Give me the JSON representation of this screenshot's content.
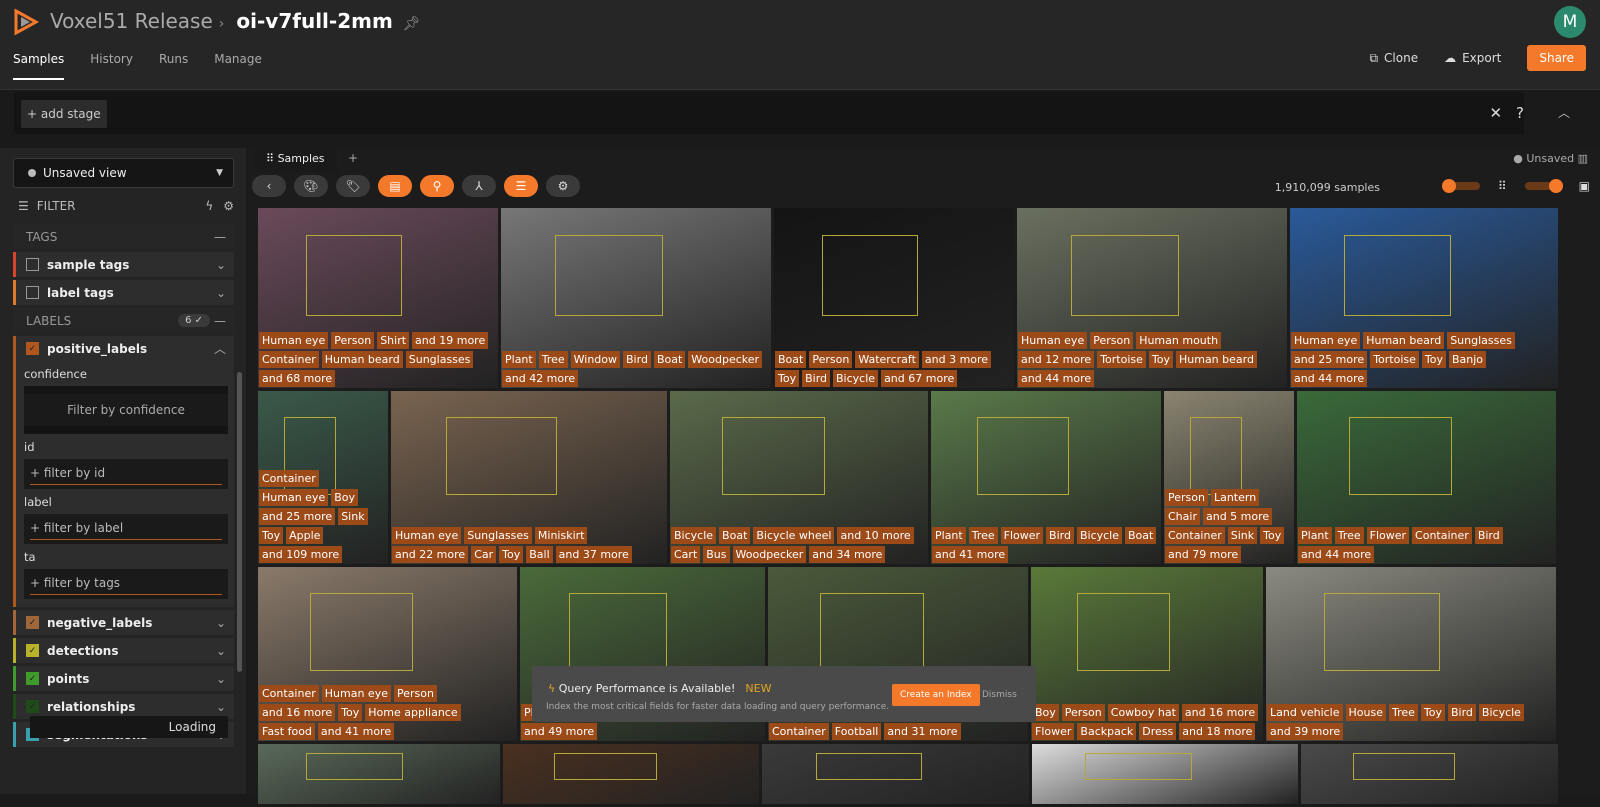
{
  "header": {
    "org": "Voxel51 Release",
    "dataset": "oi-v7full-2mm",
    "avatar": "M",
    "accent": "#f5792a"
  },
  "nav": [
    {
      "label": "Samples"
    },
    {
      "label": "History"
    },
    {
      "label": "Runs"
    },
    {
      "label": "Manage"
    }
  ],
  "actions": {
    "clone": "Clone",
    "export": "Export",
    "share": "Share"
  },
  "stage": {
    "add": "+ add stage"
  },
  "sidebar": {
    "view": "Unsaved view",
    "filter": "FILTER",
    "tags_section": "TAGS",
    "labels_section": "LABELS",
    "labels_count": "6 ✓",
    "sample_tags": "sample tags",
    "label_tags": "label tags",
    "positive": "positive_labels",
    "confidence": "confidence",
    "confidence_placeholder": "Filter by confidence",
    "id": "id",
    "id_placeholder": "+ filter by id",
    "label": "label",
    "label_placeholder": "+ filter by label",
    "tags_label": "ta",
    "tags_placeholder": "+ filter by tags",
    "loading": "Loading",
    "fields": [
      {
        "name": "negative_labels",
        "color": "#a0673a"
      },
      {
        "name": "detections",
        "color": "#b8b22a"
      },
      {
        "name": "points",
        "color": "#3f9b2c"
      },
      {
        "name": "relationships",
        "color": "#1f4a1a"
      },
      {
        "name": "segmentations",
        "color": "#3aa0b0"
      }
    ]
  },
  "grid": {
    "tab": "Samples",
    "unsaved": "Unsaved",
    "count": "1,910,099 samples",
    "rows": [
      [
        {
          "w": 240,
          "c": "#6a4a5a",
          "l": [
            "Human eye",
            "Person",
            "Shirt",
            "and 19 more",
            "Container",
            "Human beard",
            "Sunglasses",
            "and 68 more"
          ]
        },
        {
          "w": 270,
          "c": "#777777",
          "l": [
            "Plant",
            "Tree",
            "Window",
            "Bird",
            "Boat",
            "Woodpecker",
            "and 42 more"
          ]
        },
        {
          "w": 240,
          "c": "#141414",
          "l": [
            "Boat",
            "Person",
            "Watercraft",
            "and 3 more",
            "Toy",
            "Bird",
            "Bicycle",
            "and 67 more"
          ]
        },
        {
          "w": 270,
          "c": "#6a7060",
          "l": [
            "Human eye",
            "Person",
            "Human mouth",
            "and 12 more",
            "Tortoise",
            "Toy",
            "Human beard",
            "and 44 more"
          ]
        },
        {
          "w": 268,
          "c": "#2a5a9a",
          "l": [
            "Human eye",
            "Human beard",
            "Sunglasses",
            "and 25 more",
            "Tortoise",
            "Toy",
            "Banjo",
            "and 44 more"
          ]
        }
      ],
      [
        {
          "w": 130,
          "c": "#3a5a4a",
          "l": [
            "Container",
            "Human eye",
            "Boy",
            "and 25 more",
            "Sink",
            "Toy",
            "Apple",
            "and 109 more"
          ]
        },
        {
          "w": 276,
          "c": "#7a6450",
          "l": [
            "Human eye",
            "Sunglasses",
            "Miniskirt",
            "and 22 more",
            "Car",
            "Toy",
            "Ball",
            "and 37 more"
          ]
        },
        {
          "w": 258,
          "c": "#5a6a4a",
          "l": [
            "Bicycle",
            "Boat",
            "Bicycle wheel",
            "and 10 more",
            "Cart",
            "Bus",
            "Woodpecker",
            "and 34 more"
          ]
        },
        {
          "w": 230,
          "c": "#5a7a4a",
          "l": [
            "Plant",
            "Tree",
            "Flower",
            "Bird",
            "Bicycle",
            "Boat",
            "and 41 more"
          ]
        },
        {
          "w": 130,
          "c": "#8a8470",
          "l": [
            "Person",
            "Lantern",
            "Chair",
            "and 5 more",
            "Container",
            "Sink",
            "Toy",
            "and 79 more"
          ]
        },
        {
          "w": 259,
          "c": "#3a6a3a",
          "l": [
            "Plant",
            "Tree",
            "Flower",
            "Container",
            "Bird",
            "and 44 more"
          ]
        }
      ],
      [
        {
          "w": 259,
          "c": "#8a7a6a",
          "l": [
            "Container",
            "Human eye",
            "Person",
            "and 16 more",
            "Toy",
            "Home appliance",
            "Fast food",
            "and 41 more"
          ]
        },
        {
          "w": 245,
          "c": "#4a6a3a",
          "l": [
            "Plant",
            "Tree",
            "Toy",
            "Bird",
            "Bicycle",
            "and 49 more"
          ]
        },
        {
          "w": 260,
          "c": "#4a5a3a",
          "l": [
            "Container",
            "Football",
            "and 31 more"
          ]
        },
        {
          "w": 232,
          "c": "#5a7a3a",
          "l": [
            "Boy",
            "Person",
            "Cowboy hat",
            "and 16 more",
            "Flower",
            "Backpack",
            "Dress",
            "and 18 more"
          ]
        },
        {
          "w": 290,
          "c": "#8a8a80",
          "l": [
            "Land vehicle",
            "House",
            "Tree",
            "Toy",
            "Bird",
            "Bicycle",
            "and 39 more"
          ]
        }
      ],
      [
        {
          "w": 245,
          "c": "#5a6a5a",
          "l": []
        },
        {
          "w": 260,
          "c": "#4a3020",
          "l": []
        },
        {
          "w": 270,
          "c": "#3a3a3a",
          "l": []
        },
        {
          "w": 270,
          "c": "#dddddd",
          "l": []
        },
        {
          "w": 260,
          "c": "#4a4a4a",
          "l": []
        }
      ]
    ]
  },
  "toast": {
    "title": "Query Performance is Available!",
    "new": "NEW",
    "subtitle": "Index the most critical fields for faster data loading and query performance.",
    "create": "Create an Index",
    "dismiss": "Dismiss"
  }
}
